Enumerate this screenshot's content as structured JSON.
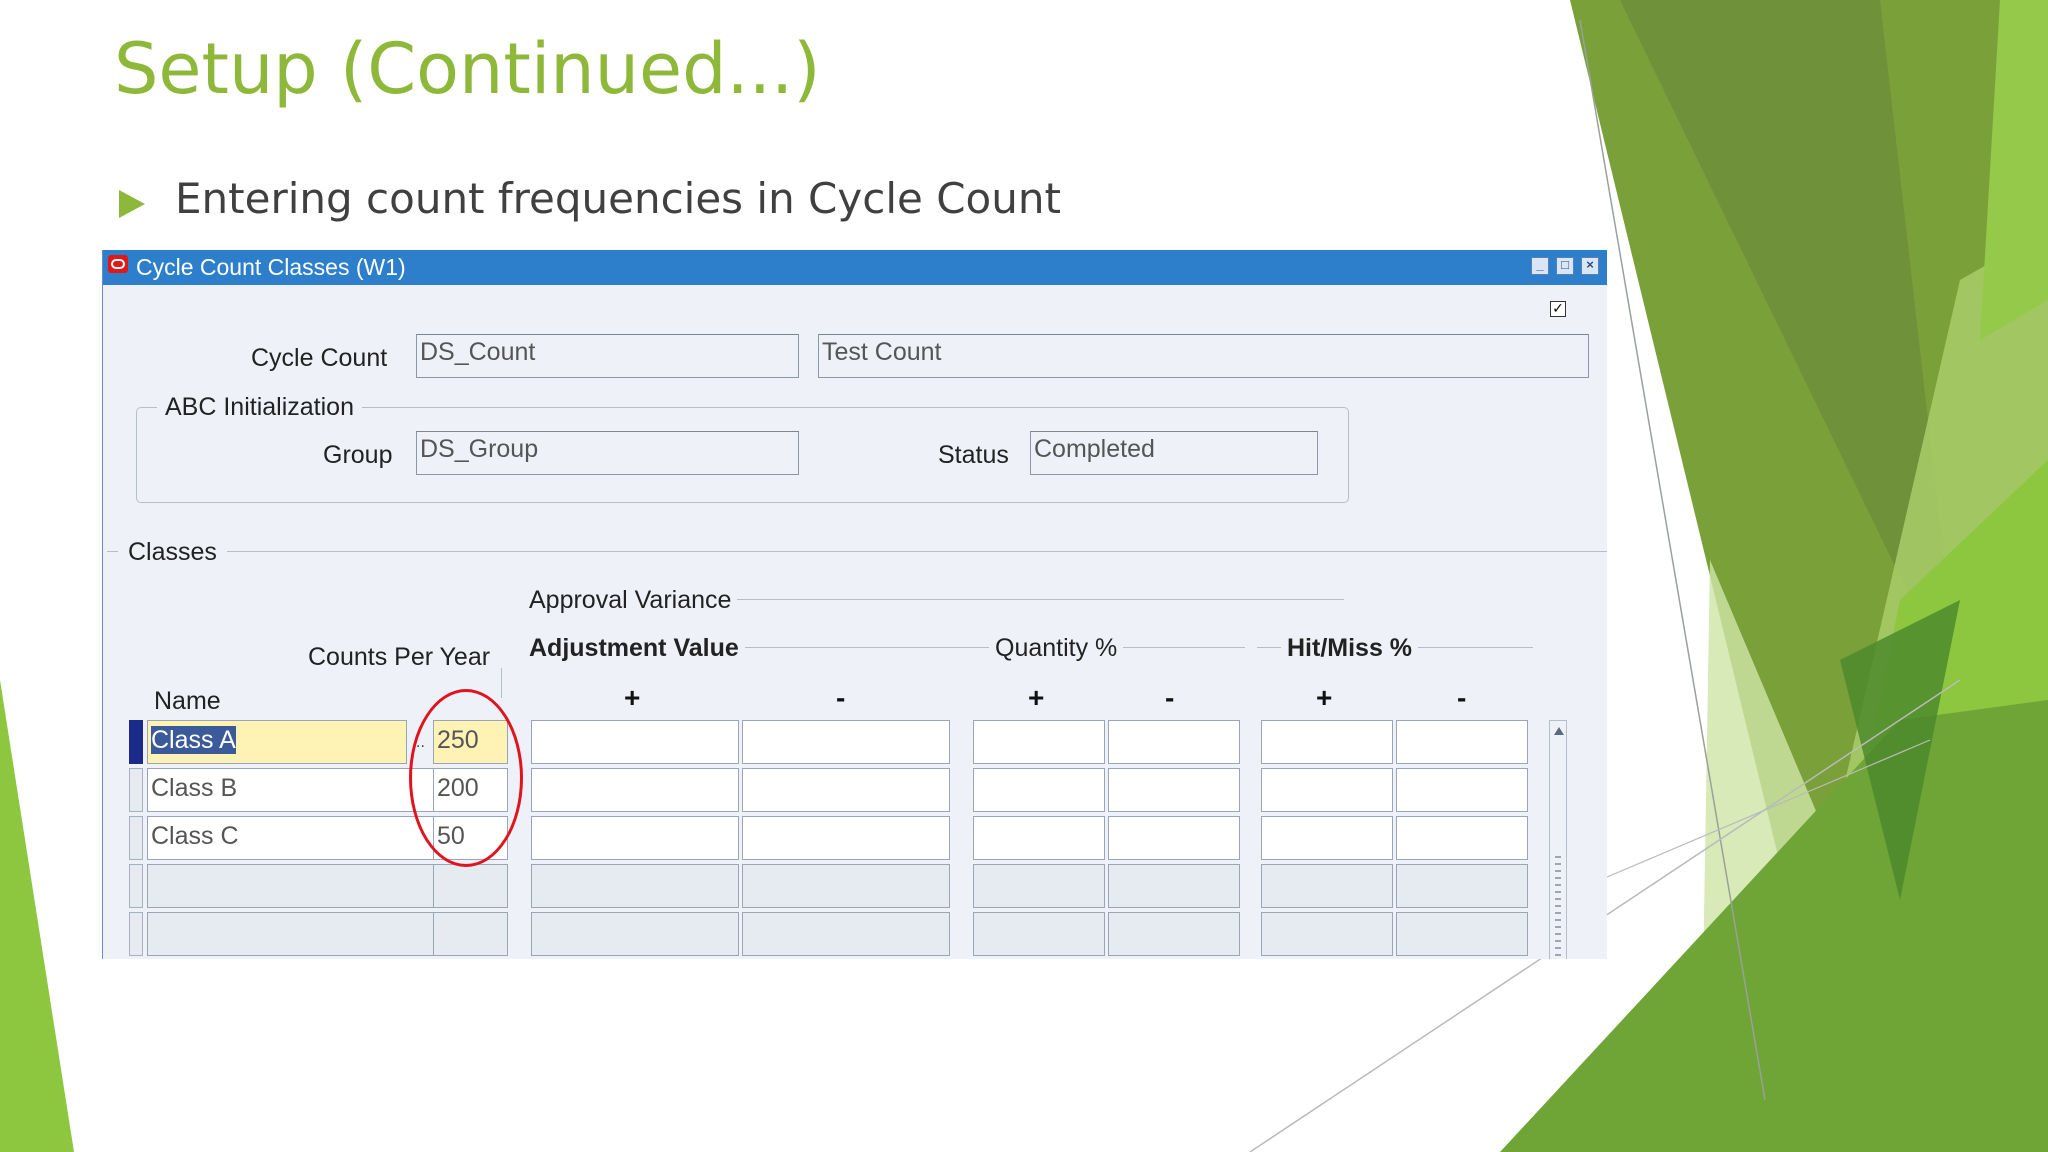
{
  "slide": {
    "title": "Setup (Continued...)",
    "bullet": "Entering count frequencies in Cycle Count",
    "accent_color": "#8DB83A"
  },
  "window": {
    "title": "Cycle Count Classes (W1)",
    "title_icon": "oracle-icon",
    "controls": {
      "minimize": "minimize-icon",
      "maximize": "maximize-icon",
      "close": "close-icon"
    },
    "titlebar_color": "#2E7FCB",
    "checkbox_checked": true
  },
  "form": {
    "cycle_count_label": "Cycle Count",
    "cycle_count_value": "DS_Count",
    "cycle_count_description": "Test Count",
    "abc_section_label": "ABC Initialization",
    "group_label": "Group",
    "group_value": "DS_Group",
    "status_label": "Status",
    "status_value": "Completed"
  },
  "classes": {
    "section_label": "Classes",
    "approval_variance_label": "Approval Variance",
    "name_header": "Name",
    "counts_header": "Counts Per Year",
    "adjustment_value_header": "Adjustment Value",
    "quantity_header": "Quantity %",
    "hitmiss_header": "Hit/Miss %",
    "plus": "+",
    "minus": "-",
    "rows": [
      {
        "name": "Class A",
        "counts": "250"
      },
      {
        "name": "Class B",
        "counts": "200"
      },
      {
        "name": "Class C",
        "counts": "50"
      }
    ],
    "lov_indicator": "··"
  }
}
